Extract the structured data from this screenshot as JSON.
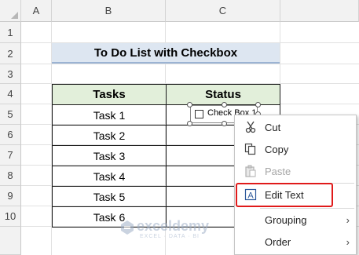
{
  "columns": [
    "A",
    "B",
    "C"
  ],
  "rows": [
    "1",
    "2",
    "3",
    "4",
    "5",
    "6",
    "7",
    "8",
    "9",
    "10"
  ],
  "title": "To Do List with Checkbox",
  "table": {
    "headers": [
      "Tasks",
      "Status"
    ],
    "tasks": [
      "Task 1",
      "Task 2",
      "Task 3",
      "Task 4",
      "Task 5",
      "Task 6"
    ]
  },
  "checkbox": {
    "label": "Check Box 1",
    "checked": false
  },
  "context_menu": {
    "items": [
      {
        "label": "Cut",
        "icon": "scissors-icon",
        "enabled": true,
        "glyph": "✂"
      },
      {
        "label": "Copy",
        "icon": "copy-icon",
        "enabled": true,
        "glyph": "⧉"
      },
      {
        "label": "Paste",
        "icon": "paste-icon",
        "enabled": false,
        "glyph": "📋"
      },
      {
        "label": "Edit Text",
        "icon": "edit-text-icon",
        "enabled": true,
        "glyph": "A",
        "highlighted": true
      },
      {
        "label": "Grouping",
        "icon": "",
        "enabled": true,
        "submenu": true
      },
      {
        "label": "Order",
        "icon": "",
        "enabled": true,
        "submenu": true
      }
    ],
    "submenu_arrow": "›"
  },
  "watermark": {
    "name": "exceldemy",
    "tagline": "EXCEL · DATA · BI"
  },
  "colors": {
    "header_fill": "#e2efda",
    "title_fill": "#dde6f1",
    "highlight": "#e01a1a"
  }
}
